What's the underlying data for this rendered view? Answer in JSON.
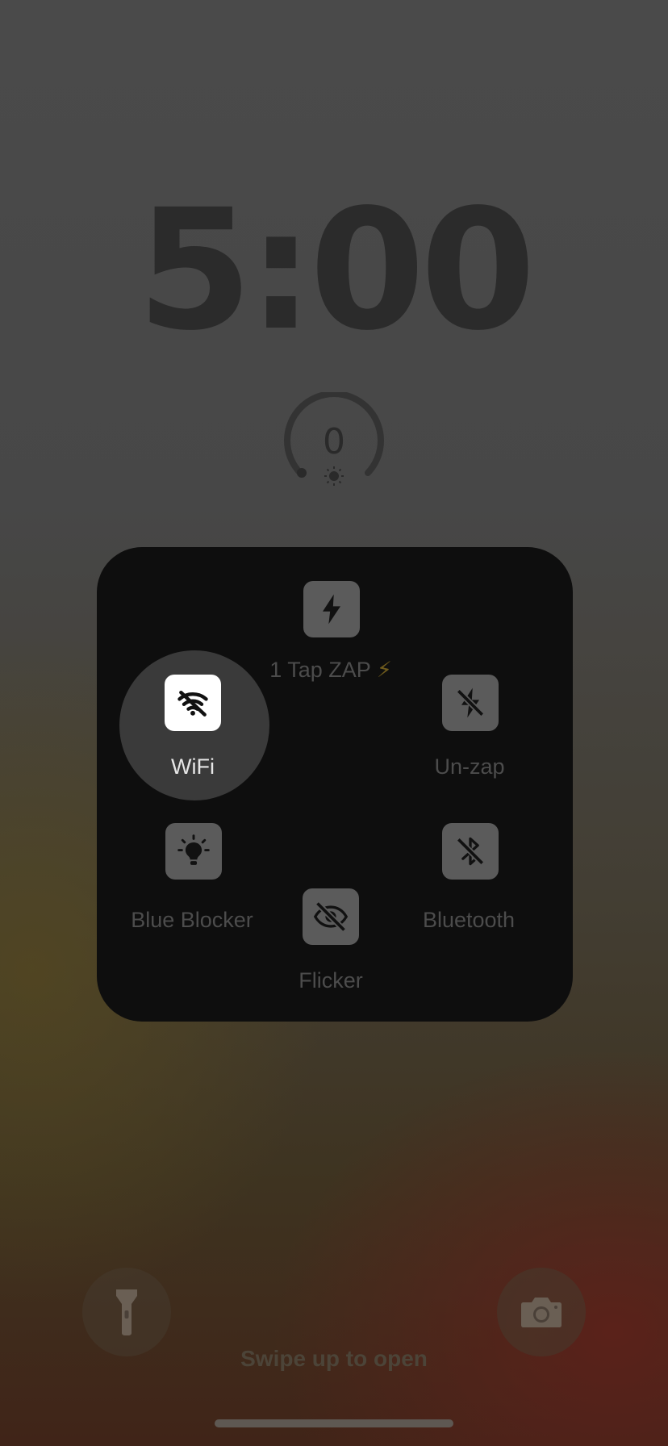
{
  "lock_screen": {
    "time": "5:00",
    "gauge_value": "0",
    "hint": "Swipe up to open"
  },
  "menu": {
    "items": [
      {
        "label": "1 Tap ZAP",
        "emoji": "⚡",
        "icon": "bolt-icon",
        "active": false
      },
      {
        "label": "WiFi",
        "icon": "wifi-off-icon",
        "active": true
      },
      {
        "label": "Un-zap",
        "icon": "bolt-slash-icon",
        "active": false
      },
      {
        "label": "Blue Blocker",
        "icon": "lightbulb-icon",
        "active": false
      },
      {
        "label": "Flicker",
        "icon": "eye-slash-icon",
        "active": false
      },
      {
        "label": "Bluetooth",
        "icon": "bluetooth-slash-icon",
        "active": false
      }
    ]
  },
  "colors": {
    "panel": "#0e0e0e",
    "tile": "#5b5b5b",
    "active_tile": "#ffffff",
    "selected_disc": "#3a3a3a"
  }
}
